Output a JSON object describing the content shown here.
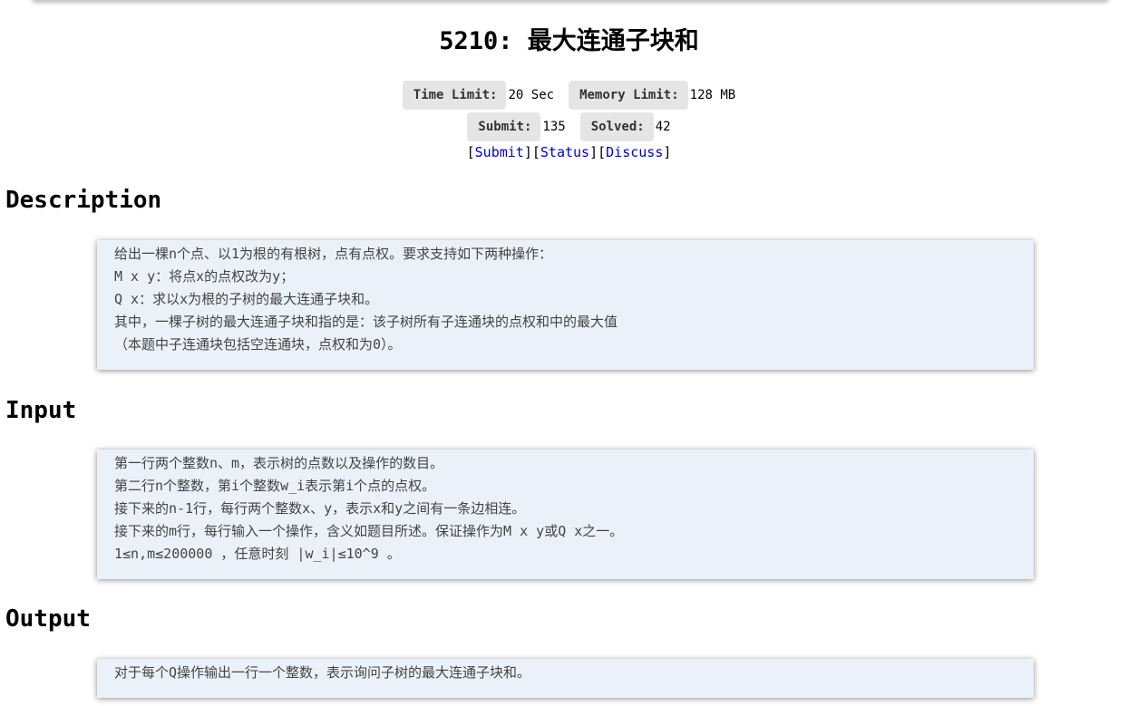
{
  "problem": {
    "title": "5210: 最大连通子块和"
  },
  "meta": {
    "time_limit_label": "Time Limit:",
    "time_limit_value": "20 Sec",
    "memory_limit_label": "Memory Limit:",
    "memory_limit_value": "128 MB",
    "submit_label": "Submit:",
    "submit_value": "135",
    "solved_label": "Solved:",
    "solved_value": "42"
  },
  "links": {
    "submit": "Submit",
    "status": "Status",
    "discuss": "Discuss"
  },
  "sections": {
    "description": {
      "heading": "Description",
      "lines": [
        "给出一棵n个点、以1为根的有根树，点有点权。要求支持如下两种操作：",
        "M x y：将点x的点权改为y；",
        "Q x：求以x为根的子树的最大连通子块和。",
        "其中，一棵子树的最大连通子块和指的是：该子树所有子连通块的点权和中的最大值",
        "（本题中子连通块包括空连通块，点权和为0）。"
      ]
    },
    "input": {
      "heading": "Input",
      "lines": [
        "第一行两个整数n、m，表示树的点数以及操作的数目。",
        "第二行n个整数，第i个整数w_i表示第i个点的点权。",
        "接下来的n-1行，每行两个整数x、y，表示x和y之间有一条边相连。",
        "接下来的m行，每行输入一个操作，含义如题目所述。保证操作为M x y或Q x之一。",
        "1≤n,m≤200000 ，任意时刻 |w_i|≤10^9 。"
      ]
    },
    "output": {
      "heading": "Output",
      "lines": [
        "对于每个Q操作输出一行一个整数，表示询问子树的最大连通子块和。"
      ]
    }
  }
}
